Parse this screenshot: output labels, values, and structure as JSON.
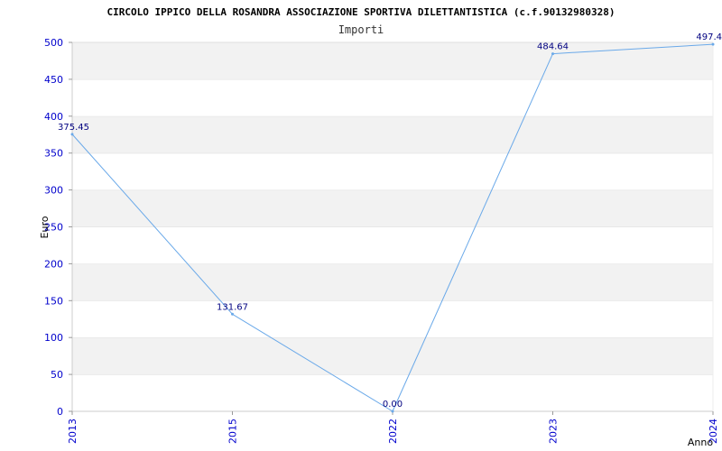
{
  "chart_data": {
    "type": "line",
    "title": "CIRCOLO IPPICO DELLA ROSANDRA ASSOCIAZIONE SPORTIVA DILETTANTISTICA (c.f.90132980328)",
    "subtitle": "Importi",
    "xlabel": "Anno",
    "ylabel": "Euro",
    "categories": [
      "2013",
      "2015",
      "2022",
      "2023",
      "2024"
    ],
    "values": [
      375.45,
      131.67,
      0.0,
      484.64,
      497.4
    ],
    "data_labels": [
      "375.45",
      "131.67",
      "0.00",
      "484.64",
      "497.4"
    ],
    "ylim": [
      0,
      500
    ],
    "yticks": [
      0,
      50,
      100,
      150,
      200,
      250,
      300,
      350,
      400,
      450,
      500
    ],
    "grid": "horizontal bands",
    "colors": {
      "line": "#6aa9e9",
      "band": "#f2f2f2",
      "tick": "#0000cc",
      "label": "#000080"
    }
  }
}
